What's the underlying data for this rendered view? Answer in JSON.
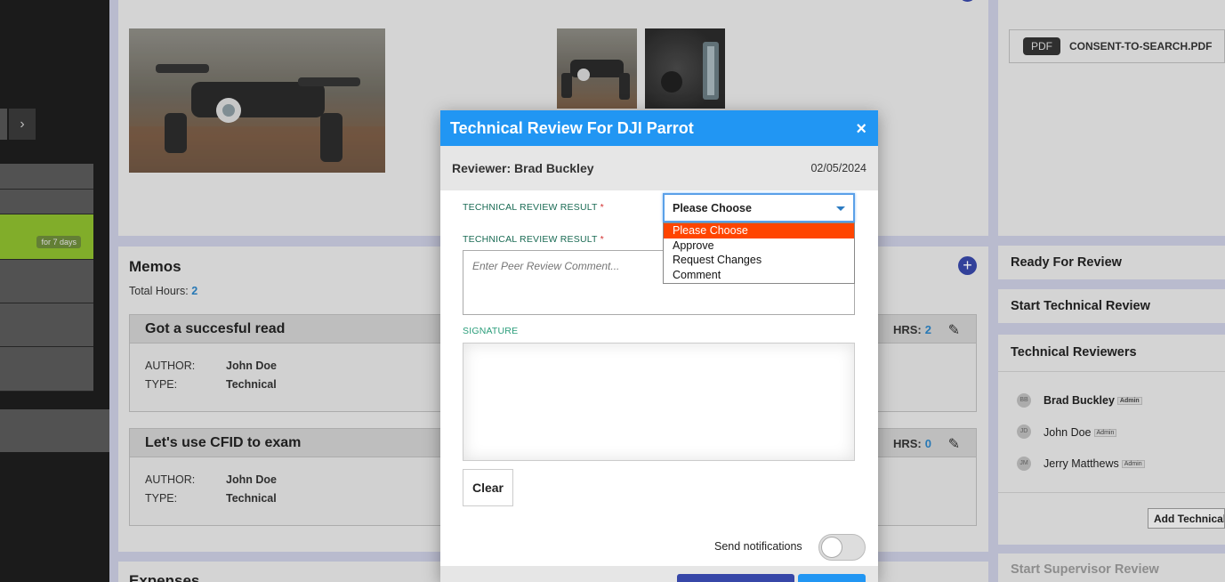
{
  "sidebar": {
    "arrow_icon": "chevron-right-icon",
    "badge": "for 7 days"
  },
  "images_panel": {
    "images": [
      "drone-photo-main",
      "drone-photo-thumb-1",
      "drone-photo-thumb-2"
    ]
  },
  "attachments": {
    "file_type": "PDF",
    "file_name": "CONSENT-TO-SEARCH.PDF"
  },
  "memos": {
    "title": "Memos",
    "total_hours_label": "Total Hours:",
    "total_hours": "2",
    "items": [
      {
        "title": "Got a succesful read",
        "hrs_label": "HRS:",
        "hrs": "2",
        "author_label": "AUTHOR:",
        "author": "John Doe",
        "type_label": "TYPE:",
        "type": "Technical"
      },
      {
        "title": "Let's use CFID to exam",
        "hrs_label": "HRS:",
        "hrs": "0",
        "author_label": "AUTHOR:",
        "author": "John Doe",
        "type_label": "TYPE:",
        "type": "Technical"
      }
    ]
  },
  "expenses": {
    "title": "Expenses"
  },
  "right_panel": {
    "ready_for_review": "Ready For Review",
    "start_technical_review": "Start Technical Review",
    "technical_reviewers_title": "Technical Reviewers",
    "reviewers": [
      {
        "initials": "BB",
        "name": "Brad Buckley",
        "role": "Admin"
      },
      {
        "initials": "JD",
        "name": "John Doe",
        "role": "Admin"
      },
      {
        "initials": "JM",
        "name": "Jerry Matthews",
        "role": "Admin"
      }
    ],
    "add_technical": "Add Technical",
    "start_supervisor_review": "Start Supervisor Review"
  },
  "modal": {
    "title": "Technical Review For DJI Parrot",
    "close_label": "×",
    "reviewer": "Reviewer: Brad Buckley",
    "date": "02/05/2024",
    "result_label": "TECHNICAL REVIEW RESULT",
    "comment_label": "TECHNICAL REVIEW RESULT",
    "required_mark": "*",
    "select_value": "Please Choose",
    "options": [
      "Please Choose",
      "Approve",
      "Request Changes",
      "Comment"
    ],
    "comment_placeholder": "Enter Peer Review Comment...",
    "signature_label": "SIGNATURE",
    "clear_label": "Clear",
    "notifications_label": "Send notifications",
    "notifications_on": false
  },
  "colors": {
    "accent": "#2196f3",
    "highlight": "#ff4500",
    "primary_dark": "#3747a8",
    "label_green": "#1a6b54"
  }
}
